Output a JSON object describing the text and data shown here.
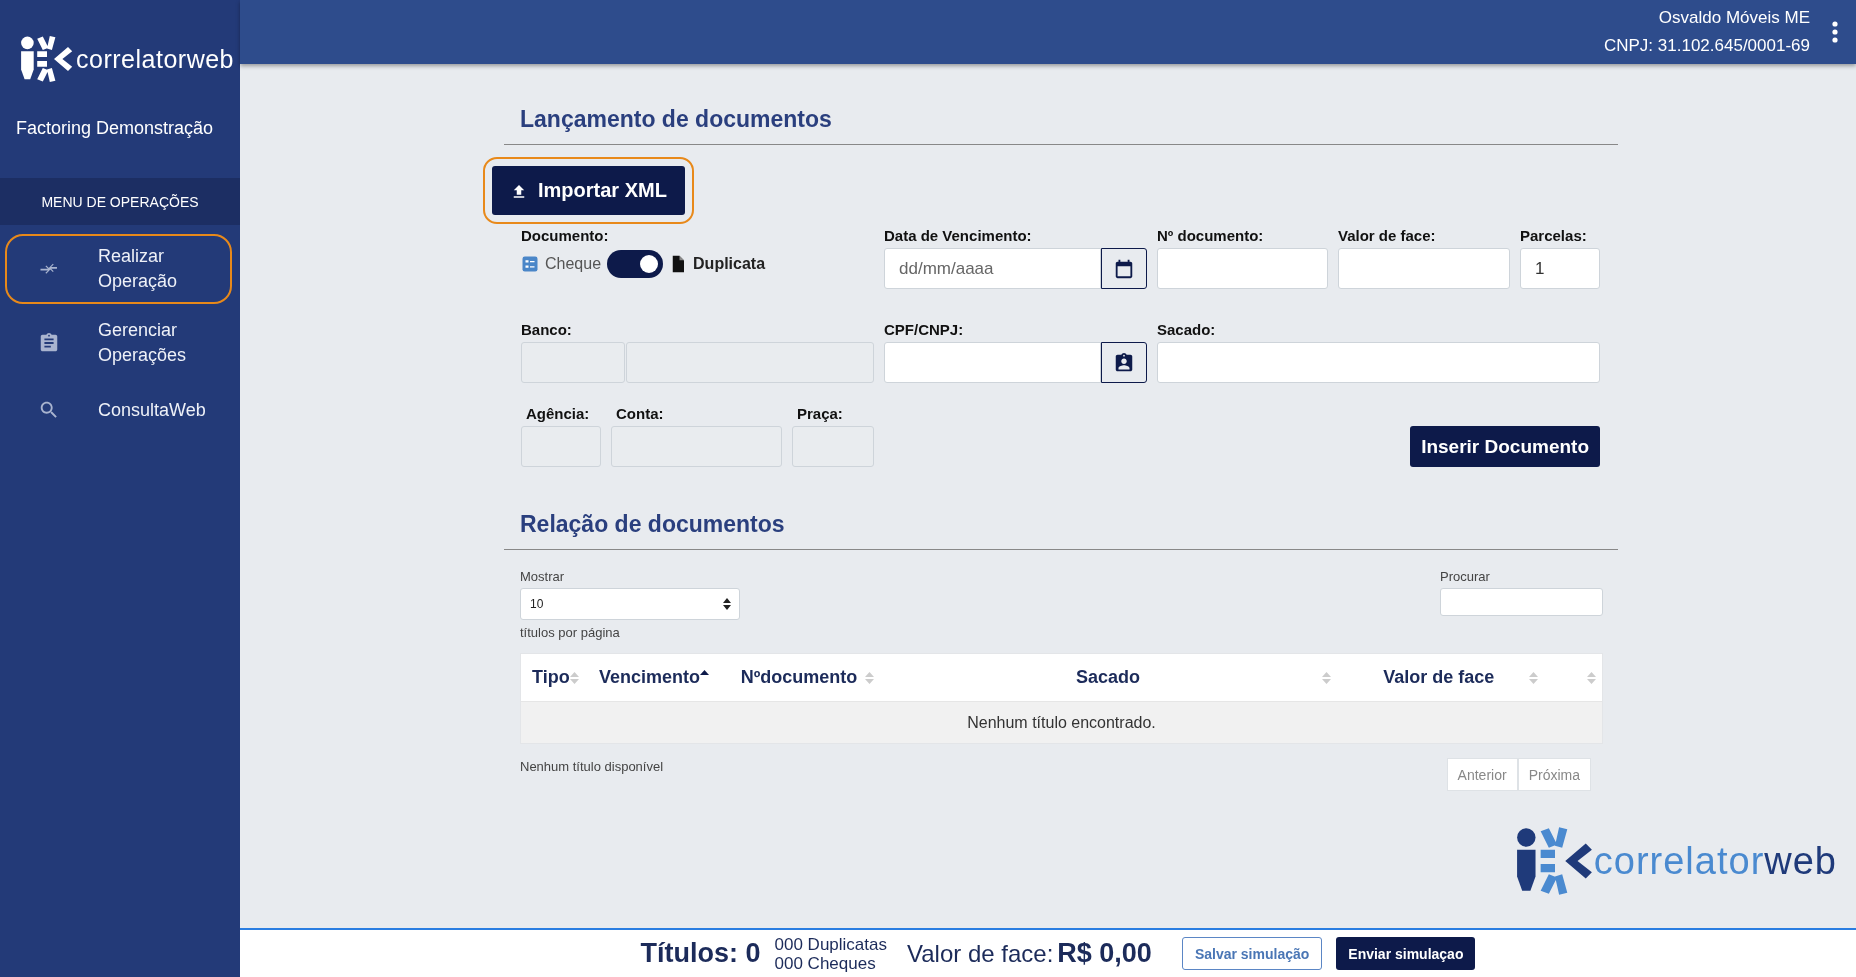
{
  "sidebar": {
    "brand": "correlatorweb",
    "company": "Factoring Demonstração",
    "menu_title": "MENU DE OPERAÇÕES",
    "items": [
      {
        "label": "Realizar Operação",
        "selected": true
      },
      {
        "label": "Gerenciar Operações",
        "selected": false
      },
      {
        "label": "ConsultaWeb",
        "selected": false
      }
    ]
  },
  "header": {
    "client": "Osvaldo Móveis ME",
    "cnpj": "CNPJ: 31.102.645/0001-69"
  },
  "launch": {
    "title": "Lançamento de documentos",
    "import_button": {
      "label": "Importar XML",
      "focused": true
    },
    "document": {
      "label": "Documento:",
      "options": [
        {
          "label": "Cheque",
          "selected": false
        },
        {
          "label": "Duplicata",
          "selected": true
        }
      ]
    },
    "due_date": {
      "label": "Data de Vencimento:",
      "placeholder": "dd/mm/aaaa"
    },
    "doc_number": {
      "label": "Nº documento:"
    },
    "face_value": {
      "label": "Valor de face:"
    },
    "installments": {
      "label": "Parcelas:",
      "value": "1"
    },
    "bank": {
      "label": "Banco:",
      "disabled": true
    },
    "cpf_cnpj": {
      "label": "CPF/CNPJ:"
    },
    "drawee": {
      "label": "Sacado:"
    },
    "agency": {
      "label": "Agência:",
      "disabled": true
    },
    "account": {
      "label": "Conta:",
      "disabled": true
    },
    "place": {
      "label": "Praça:",
      "disabled": true
    },
    "insert_button": {
      "label": "Inserir Documento"
    }
  },
  "documents": {
    "title": "Relação de documentos",
    "show_label": "Mostrar",
    "page_size": "10",
    "per_page_label": "títulos por página",
    "search_label": "Procurar",
    "columns": [
      {
        "label": "Tipo",
        "sorted_ascending": false
      },
      {
        "label": "Vencimento",
        "sorted_ascending": true
      },
      {
        "label": "Nºdocumento",
        "sorted_ascending": false
      },
      {
        "label": "Sacado",
        "sorted_ascending": false
      },
      {
        "label": "Valor de face",
        "sorted_ascending": false
      },
      {
        "sorted_ascending": false
      }
    ],
    "empty_message": "Nenhum título encontrado.",
    "info": "Nenhum título disponível",
    "pagination": [
      {
        "label": "Anterior",
        "disabled": true
      },
      {
        "label": "Próxima",
        "disabled": true
      }
    ]
  },
  "brand_logo": {
    "text": "correlator",
    "accent": "web"
  },
  "footer": {
    "titles": "Títulos: 0",
    "duplicatas": "000 Duplicatas",
    "cheques": "000 Cheques",
    "face_label": "Valor de face:",
    "face_value": "R$ 0,00",
    "buttons": [
      {
        "label": "Salvar simulação",
        "kind": "outline"
      },
      {
        "label": "Enviar simulaçao",
        "kind": "primary"
      }
    ]
  }
}
